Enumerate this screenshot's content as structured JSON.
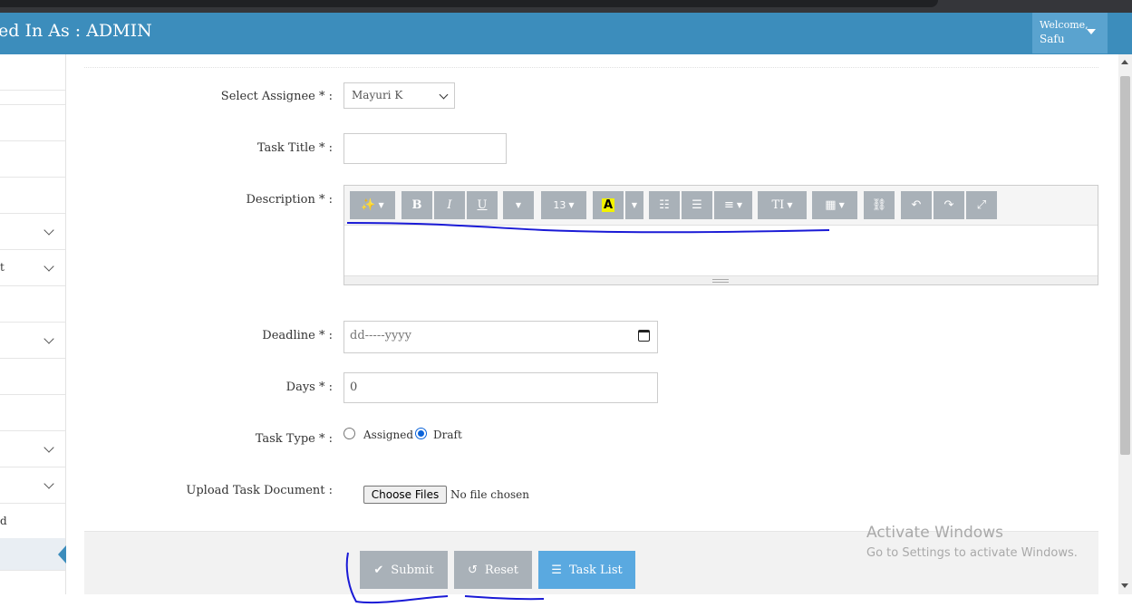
{
  "header": {
    "title": "ed In As : ADMIN",
    "welcome_line1": "Welcome,",
    "welcome_line2": "Safu"
  },
  "sidebar": {
    "items": [
      {
        "label": "",
        "expandable": false
      },
      {
        "label": "",
        "expandable": false
      },
      {
        "label": "",
        "expandable": false
      },
      {
        "label": "",
        "expandable": false
      },
      {
        "label": "",
        "expandable": true
      },
      {
        "label": "t",
        "expandable": true
      },
      {
        "label": "",
        "expandable": false
      },
      {
        "label": "",
        "expandable": true
      },
      {
        "label": "",
        "expandable": false
      },
      {
        "label": "",
        "expandable": false
      },
      {
        "label": "",
        "expandable": true
      },
      {
        "label": "",
        "expandable": true
      },
      {
        "label": "d",
        "expandable": false
      },
      {
        "label": "",
        "expandable": false,
        "active": true
      }
    ]
  },
  "form": {
    "assignee_label": "Select Assignee * :",
    "assignee_value": "Mayuri K",
    "title_label": "Task Title * :",
    "title_value": "",
    "description_label": "Description * :",
    "deadline_label": "Deadline * :",
    "deadline_placeholder": "dd-----yyyy",
    "days_label": "Days * :",
    "days_value": "0",
    "task_type_label": "Task Type * :",
    "task_type_options": [
      "Assigned",
      "Draft"
    ],
    "task_type_selected": "Draft",
    "upload_label": "Upload Task Document :",
    "choose_files": "Choose Files",
    "no_file": "No file chosen"
  },
  "editor_toolbar": {
    "magic": "magic-icon",
    "bold": "B",
    "italic": "I",
    "underline": "U",
    "font_size": "13",
    "highlight": "A",
    "ordered_list": "ordered-list-icon",
    "unordered_list": "unordered-list-icon",
    "align": "align-icon",
    "text_height": "TI",
    "table": "table-icon",
    "link": "link-icon",
    "undo": "undo-icon",
    "redo": "redo-icon",
    "fullscreen": "fullscreen-icon"
  },
  "buttons": {
    "submit": "Submit",
    "reset": "Reset",
    "task_list": "Task List"
  },
  "watermark": {
    "line1": "Activate Windows",
    "line2": "Go to Settings to activate Windows."
  },
  "colors": {
    "header": "#3c8dbc",
    "button_gray": "#a9b1b8",
    "button_blue": "#5aa9e0",
    "annotation": "#1a1ad6"
  }
}
